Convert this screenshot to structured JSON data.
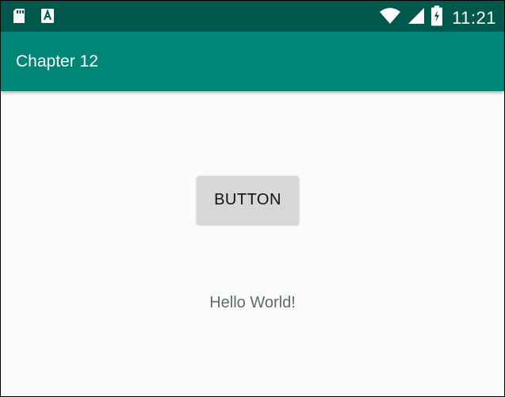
{
  "status_bar": {
    "time": "11:21",
    "left_icons": [
      "sd-card-icon",
      "a-notification-icon"
    ],
    "right_icons": [
      "wifi-icon",
      "signal-icon",
      "battery-charging-icon"
    ]
  },
  "app_bar": {
    "title": "Chapter 12"
  },
  "main": {
    "button_label": "BUTTON",
    "text_view": "Hello World!"
  },
  "colors": {
    "status_bar": "#00574b",
    "app_bar": "#008577",
    "background": "#fafafa",
    "button": "#d6d7d7",
    "hello_text": "#5d6b6c"
  }
}
